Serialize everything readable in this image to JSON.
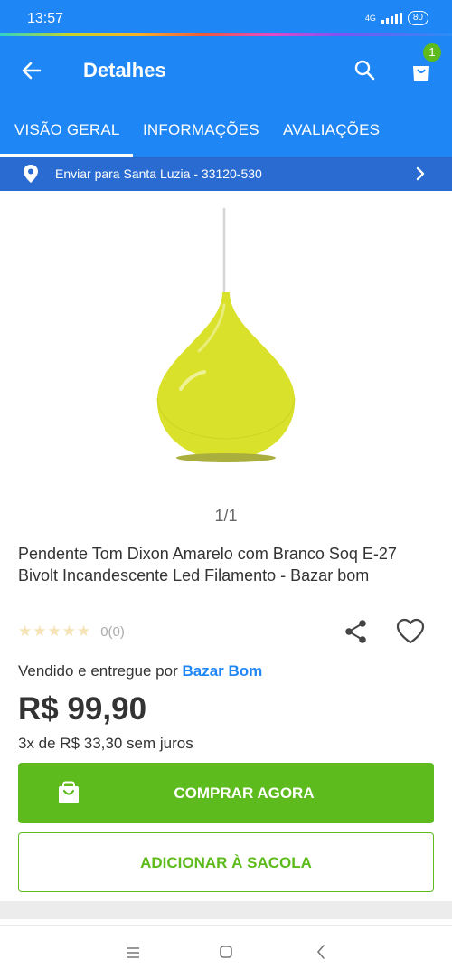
{
  "status_bar": {
    "time": "13:57",
    "network": "4G",
    "battery": "80"
  },
  "app_bar": {
    "title": "Detalhes",
    "cart_count": "1",
    "back_icon": "arrow-left-icon",
    "search_icon": "search-icon",
    "cart_icon": "shopping-bag-icon"
  },
  "tabs": [
    {
      "label": "VISÃO GERAL",
      "active": true
    },
    {
      "label": "INFORMAÇÕES",
      "active": false
    },
    {
      "label": "AVALIAÇÕES",
      "active": false
    }
  ],
  "shipping": {
    "label": "Enviar para Santa Luzia - 33120-530",
    "icon": "location-pin-icon"
  },
  "gallery": {
    "pager": "1/1"
  },
  "product": {
    "name": "Pendente Tom Dixon Amarelo com Branco Soq E-27 Bivolt Incandescente Led Filamento - Bazar bom",
    "stars": "★★★★★",
    "rating_value": 0,
    "rating_count": "0(0)",
    "seller_prefix": "Vendido e entregue por",
    "seller_name": "Bazar Bom",
    "price": "R$ 99,90",
    "installments": "3x de R$ 33,30 sem juros"
  },
  "actions": {
    "buy_now": "COMPRAR AGORA",
    "add_to_bag": "ADICIONAR À SACOLA"
  },
  "colors": {
    "primary": "#1f86f5",
    "ship_bar": "#2a6bd2",
    "green": "#5dbb1d",
    "lamp_yellow": "#d9e12a"
  }
}
